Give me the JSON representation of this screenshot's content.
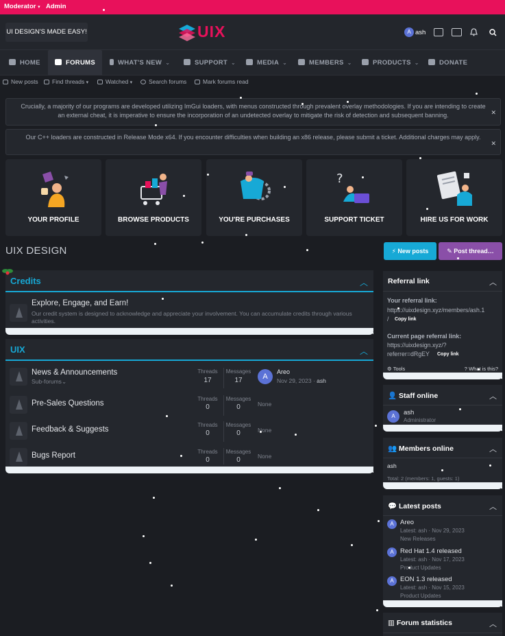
{
  "topbar": {
    "moderator": "Moderator",
    "admin": "Admin"
  },
  "header": {
    "tagline": "UI DESIGN'S MADE EASY!",
    "logo_text": "UIX",
    "user_initial": "A",
    "username": "ash"
  },
  "nav": {
    "home": "HOME",
    "forums": "FORUMS",
    "whats_new": "WHAT'S NEW",
    "support": "SUPPORT",
    "media": "MEDIA",
    "members": "MEMBERS",
    "products": "PRODUCTS",
    "donate": "DONATE"
  },
  "subnav": {
    "new_posts": "New posts",
    "find_threads": "Find threads",
    "watched": "Watched",
    "search_forums": "Search forums",
    "mark_read": "Mark forums read"
  },
  "notices": [
    {
      "text": "Crucially, a majority of our programs are developed utilizing ImGui loaders, with menus constructed through prevalent overlay methodologies. If you are intending to create an external cheat, it is imperative to ensure the incorporation of an undetected overlay to mitigate the risk of detection and subsequent banning."
    },
    {
      "text": "Our C++ loaders are constructed in Release Mode x64. If you encounter difficulties when building an x86 release, please submit a ticket. Additional charges may apply."
    }
  ],
  "tiles": [
    {
      "label": "YOUR PROFILE"
    },
    {
      "label": "BROWSE PRODUCTS"
    },
    {
      "label": "YOU'RE PURCHASES"
    },
    {
      "label": "SUPPORT TICKET"
    },
    {
      "label": "HIRE US FOR WORK"
    }
  ],
  "page_title": "UIX DESIGN",
  "actions": {
    "new_posts": "New posts",
    "post_thread": "Post thread…"
  },
  "credits_block": {
    "title": "Credits",
    "node_title": "Explore, Engage, and Earn!",
    "node_desc": "Our credit system is designed to acknowledge and appreciate your involvement. You can accumulate credits through various activities."
  },
  "uix_block": {
    "title": "UIX",
    "threads_label": "Threads",
    "messages_label": "Messages",
    "nodes": [
      {
        "title": "News & Announcements",
        "sub": "Sub-forums",
        "threads": "17",
        "messages": "17",
        "last_title": "Areo",
        "last_date": "Nov 29, 2023",
        "last_user": "ash",
        "avatar": "A"
      },
      {
        "title": "Pre-Sales Questions",
        "threads": "0",
        "messages": "0",
        "none": "None"
      },
      {
        "title": "Feedback & Suggests",
        "threads": "0",
        "messages": "0",
        "none": "None"
      },
      {
        "title": "Bugs Report",
        "threads": "0",
        "messages": "0",
        "none": "None"
      }
    ]
  },
  "referral": {
    "title": "Referral link",
    "your_label": "Your referral link:",
    "your_url_1": "https://uixdesign.xyz/members/ash.1",
    "your_url_2": "/",
    "copy": "Copy link",
    "page_label": "Current page referral link:",
    "page_url_1": "https://uixdesign.xyz/?",
    "page_url_2": "referrer=dRgEY",
    "tools": "Tools",
    "what": "What is this?"
  },
  "staff": {
    "title": "Staff online",
    "name": "ash",
    "role": "Administrator",
    "avatar": "A"
  },
  "members_online": {
    "title": "Members online",
    "name": "ash",
    "total": "Total: 2 (members: 1, guests: 1)"
  },
  "latest": {
    "title": "Latest posts",
    "posts": [
      {
        "title": "Areo",
        "meta": "Latest: ash · Nov 29, 2023",
        "forum": "New Releases",
        "avatar": "A"
      },
      {
        "title": "Red Hat 1.4 released",
        "meta": "Latest: ash · Nov 17, 2023",
        "forum": "Product Updates",
        "avatar": "A"
      },
      {
        "title": "EON 1.3 released",
        "meta": "Latest: ash · Nov 15, 2023",
        "forum": "Product Updates",
        "avatar": "A"
      }
    ]
  },
  "forum_stats": {
    "title": "Forum statistics"
  },
  "colors": {
    "accent": "#17a9d6",
    "brand": "#e8115b",
    "purple": "#8a4fa8",
    "bg": "#1b1d22",
    "panel": "#24272d"
  }
}
